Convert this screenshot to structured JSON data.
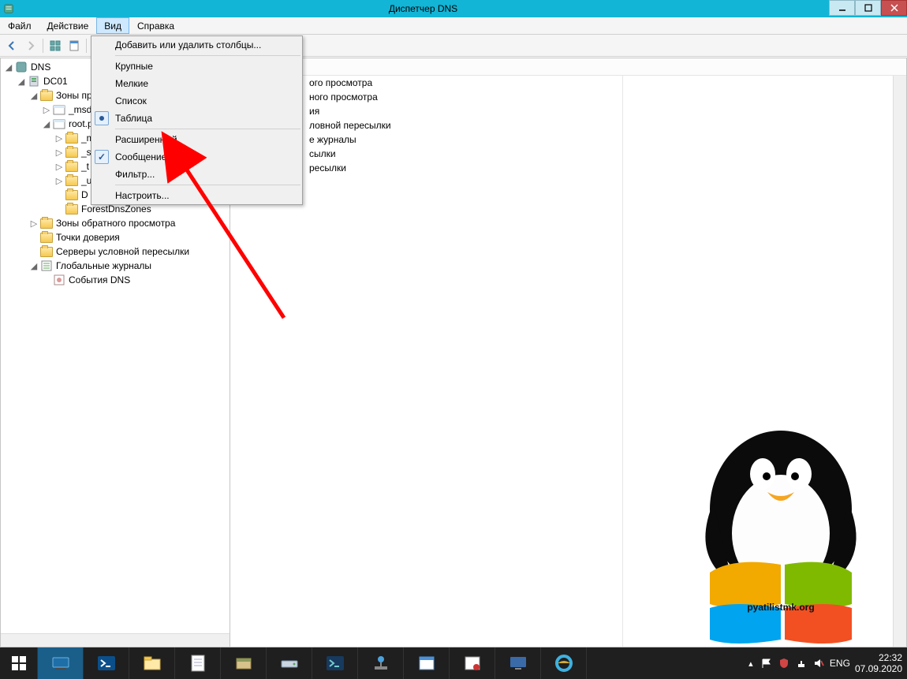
{
  "colors": {
    "titlebar": "#12b5d6",
    "close": "#c75050",
    "accent": "#0078d7"
  },
  "window": {
    "title": "Диспетчер DNS"
  },
  "menu": {
    "items": [
      "Файл",
      "Действие",
      "Вид",
      "Справка"
    ],
    "active_index": 2
  },
  "dropdown": {
    "items": [
      {
        "label": "Добавить или удалить столбцы...",
        "type": "cmd"
      },
      {
        "sep": true
      },
      {
        "label": "Крупные",
        "type": "radio",
        "checked": false
      },
      {
        "label": "Мелкие",
        "type": "radio",
        "checked": false
      },
      {
        "label": "Список",
        "type": "radio",
        "checked": false
      },
      {
        "label": "Таблица",
        "type": "radio",
        "checked": true
      },
      {
        "sep": true
      },
      {
        "label": "Расширенный",
        "type": "check",
        "checked": false
      },
      {
        "label": "Сообщение",
        "type": "check",
        "checked": true
      },
      {
        "label": "Фильтр...",
        "type": "cmd"
      },
      {
        "sep": true
      },
      {
        "label": "Настроить...",
        "type": "cmd"
      }
    ]
  },
  "tree": {
    "nodes": [
      {
        "depth": 0,
        "expand": "open",
        "icon": "dns-root",
        "label": "DNS"
      },
      {
        "depth": 1,
        "expand": "open",
        "icon": "server",
        "label": "DC01"
      },
      {
        "depth": 2,
        "expand": "open",
        "icon": "folder",
        "label": "Зоны прямого просмотра",
        "truncate": "Зоны пря"
      },
      {
        "depth": 3,
        "expand": "closed",
        "icon": "zone",
        "label": "_msdcs",
        "truncate": "_msd"
      },
      {
        "depth": 3,
        "expand": "open",
        "icon": "zone",
        "label": "root.p",
        "truncate": "root.p"
      },
      {
        "depth": 4,
        "expand": "closed",
        "icon": "folder",
        "label": "_msdcs",
        "truncate": "_m"
      },
      {
        "depth": 4,
        "expand": "closed",
        "icon": "folder",
        "label": "_sites",
        "truncate": "_si"
      },
      {
        "depth": 4,
        "expand": "closed",
        "icon": "folder",
        "label": "_tcp",
        "truncate": "_t"
      },
      {
        "depth": 4,
        "expand": "closed",
        "icon": "folder",
        "label": "_udp",
        "truncate": "_u"
      },
      {
        "depth": 4,
        "expand": "none",
        "icon": "folder",
        "label": "DomainDnsZones",
        "truncate": "D"
      },
      {
        "depth": 4,
        "expand": "none",
        "icon": "folder",
        "label": "ForestDnsZones"
      },
      {
        "depth": 2,
        "expand": "closed",
        "icon": "folder",
        "label": "Зоны обратного просмотра"
      },
      {
        "depth": 2,
        "expand": "none",
        "icon": "folder",
        "label": "Точки доверия"
      },
      {
        "depth": 2,
        "expand": "none",
        "icon": "folder",
        "label": "Серверы условной пересылки"
      },
      {
        "depth": 2,
        "expand": "open",
        "icon": "logs",
        "label": "Глобальные журналы"
      },
      {
        "depth": 3,
        "expand": "none",
        "icon": "event",
        "label": "События DNS"
      }
    ]
  },
  "list": {
    "rows": [
      {
        "icon": "folder",
        "partial_text": "ого просмотра",
        "full_text": "Зоны прямого просмотра"
      },
      {
        "icon": "folder",
        "partial_text": "ного просмотра",
        "full_text": "Зоны обратного просмотра"
      },
      {
        "icon": "folder",
        "partial_text": "ия",
        "full_text": "Точки доверия"
      },
      {
        "icon": "folder",
        "partial_text": "ловной пересылки",
        "full_text": "Серверы условной пересылки"
      },
      {
        "icon": "logs",
        "partial_text": "е журналы",
        "full_text": "Глобальные журналы"
      },
      {
        "icon": "fwd",
        "partial_text": "сылки",
        "full_text": "Пересылки"
      },
      {
        "icon": "fwd",
        "partial_text": "ресылки",
        "full_text": "Пересылки"
      }
    ]
  },
  "watermark_text": "pyatilistmk.org",
  "taskbar": {
    "buttons": [
      "start",
      "server",
      "powershell",
      "explorer",
      "text",
      "servermgr",
      "drive",
      "powershell2",
      "network",
      "dns",
      "dns2",
      "remote",
      "ie"
    ],
    "lang": "ENG",
    "time": "22:32",
    "date": "07.09.2020"
  }
}
